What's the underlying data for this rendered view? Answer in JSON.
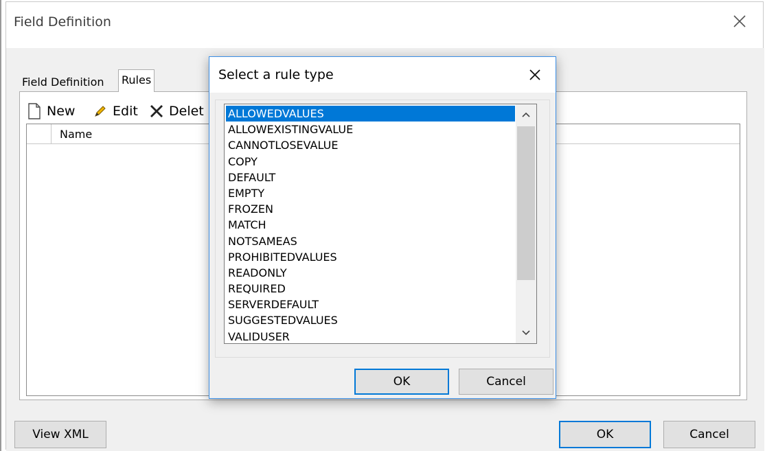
{
  "window": {
    "title": "Field Definition"
  },
  "tabs": [
    {
      "label": "Field Definition"
    },
    {
      "label": "Rules"
    }
  ],
  "toolbar": {
    "new_label": "New",
    "edit_label": "Edit",
    "delete_label": "Delet"
  },
  "grid": {
    "column_name": "Name"
  },
  "footer": {
    "view_xml_label": "View XML",
    "ok_label": "OK",
    "cancel_label": "Cancel"
  },
  "dialog": {
    "title": "Select a rule type",
    "items": [
      "ALLOWEDVALUES",
      "ALLOWEXISTINGVALUE",
      "CANNOTLOSEVALUE",
      "COPY",
      "DEFAULT",
      "EMPTY",
      "FROZEN",
      "MATCH",
      "NOTSAMEAS",
      "PROHIBITEDVALUES",
      "READONLY",
      "REQUIRED",
      "SERVERDEFAULT",
      "SUGGESTEDVALUES",
      "VALIDUSER"
    ],
    "selected_item": "ALLOWEDVALUES",
    "ok_label": "OK",
    "cancel_label": "Cancel"
  },
  "colors": {
    "accent": "#0078d7",
    "button_bg": "#e1e1e1",
    "panel_bg": "#f0f0f0"
  },
  "icons": {
    "new": "new-document-icon",
    "edit": "pencil-icon",
    "delete": "delete-x-icon",
    "close": "close-icon",
    "scroll_up": "chevron-up-icon",
    "scroll_down": "chevron-down-icon"
  }
}
